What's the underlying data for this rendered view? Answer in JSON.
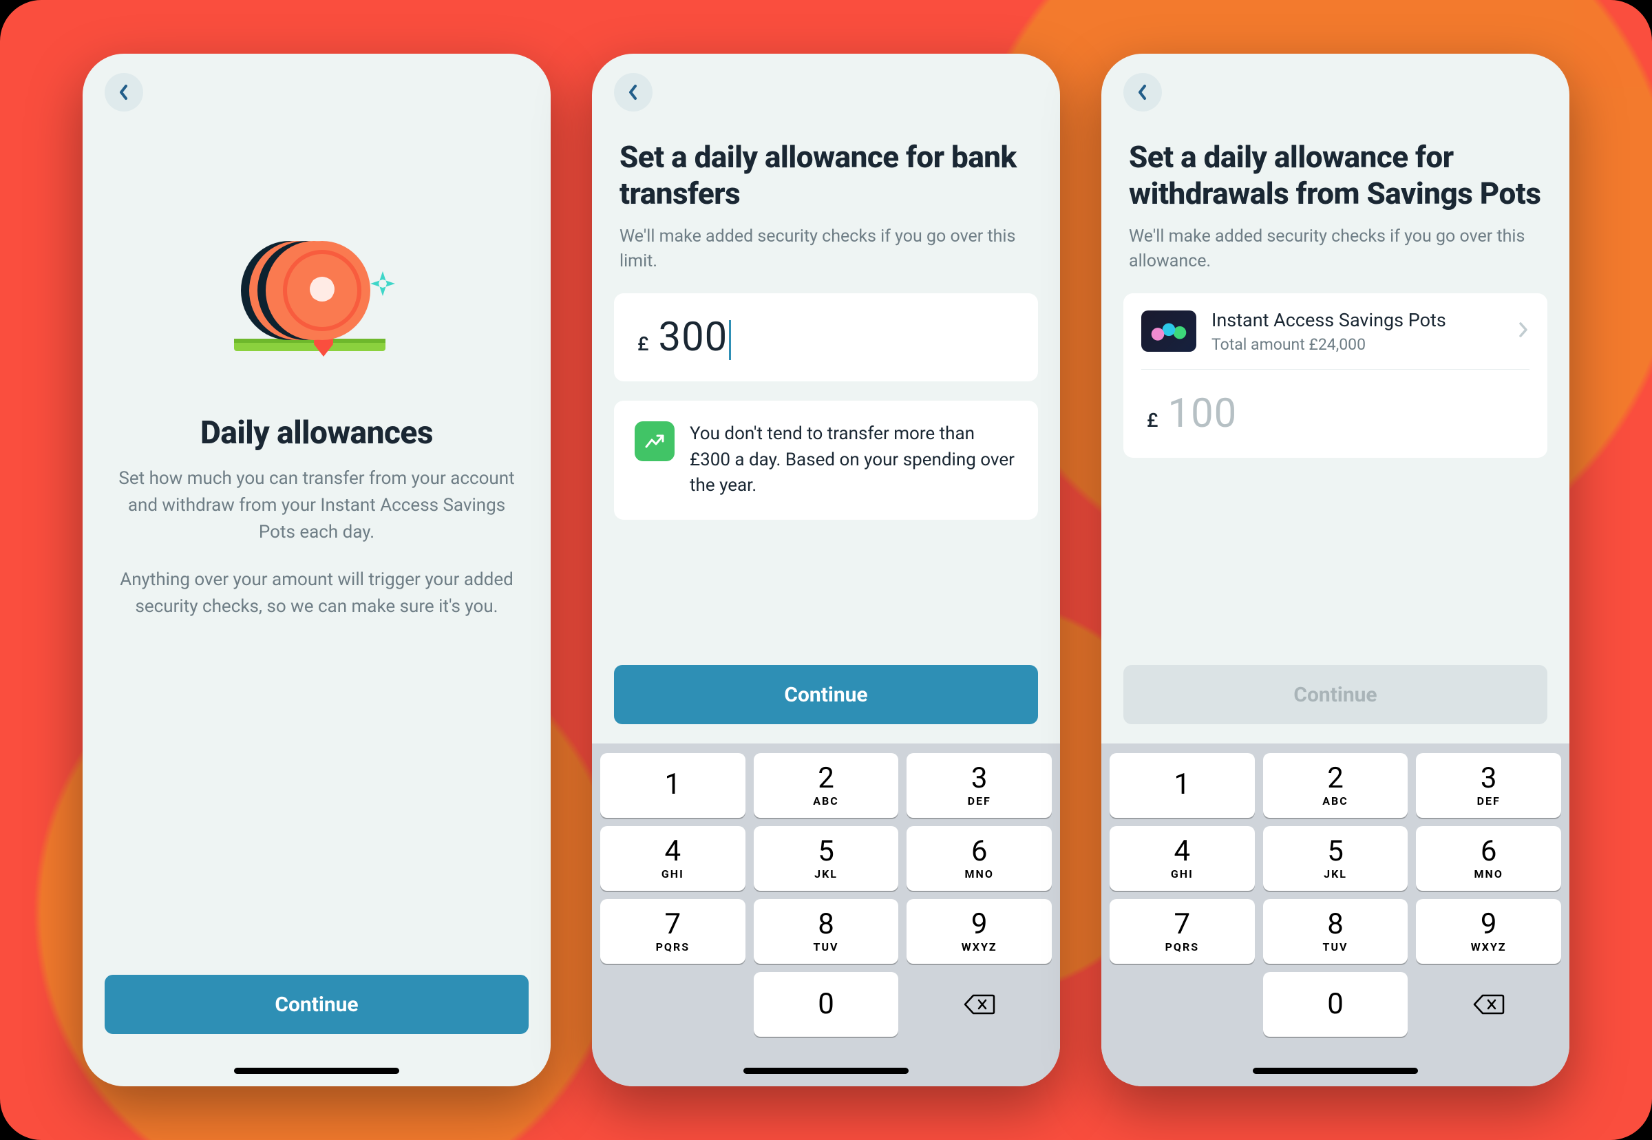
{
  "colors": {
    "accent": "#2e8fb5",
    "background": "#eef4f3",
    "text": "#1a2733",
    "muted": "#6e7d85",
    "success": "#41c466",
    "disabled": "#dbe3e5"
  },
  "screen1": {
    "title": "Daily allowances",
    "body1": "Set how much you can transfer from your account and withdraw from your Instant Access Savings Pots each day.",
    "body2": "Anything over your amount will trigger your added security checks, so we can make sure it's you.",
    "continue": "Continue"
  },
  "screen2": {
    "title": "Set a daily allowance for bank transfers",
    "subtitle": "We'll make added security checks if you go over this limit.",
    "currency": "£",
    "amount": "300",
    "info": "You don't tend to transfer more than £300 a day. Based on your spending over the year.",
    "continue": "Continue",
    "continue_enabled": true
  },
  "screen3": {
    "title": "Set a daily allowance for withdrawals from Savings Pots",
    "subtitle": "We'll make added security checks if you go over this allowance.",
    "pot": {
      "name": "Instant Access Savings Pots",
      "subtitle": "Total amount £24,000"
    },
    "currency": "£",
    "amount_placeholder": "100",
    "continue": "Continue",
    "continue_enabled": false
  },
  "keypad": {
    "keys": [
      {
        "d": "1",
        "l": ""
      },
      {
        "d": "2",
        "l": "ABC"
      },
      {
        "d": "3",
        "l": "DEF"
      },
      {
        "d": "4",
        "l": "GHI"
      },
      {
        "d": "5",
        "l": "JKL"
      },
      {
        "d": "6",
        "l": "MNO"
      },
      {
        "d": "7",
        "l": "PQRS"
      },
      {
        "d": "8",
        "l": "TUV"
      },
      {
        "d": "9",
        "l": "WXYZ"
      },
      {
        "d": "0",
        "l": ""
      }
    ]
  }
}
